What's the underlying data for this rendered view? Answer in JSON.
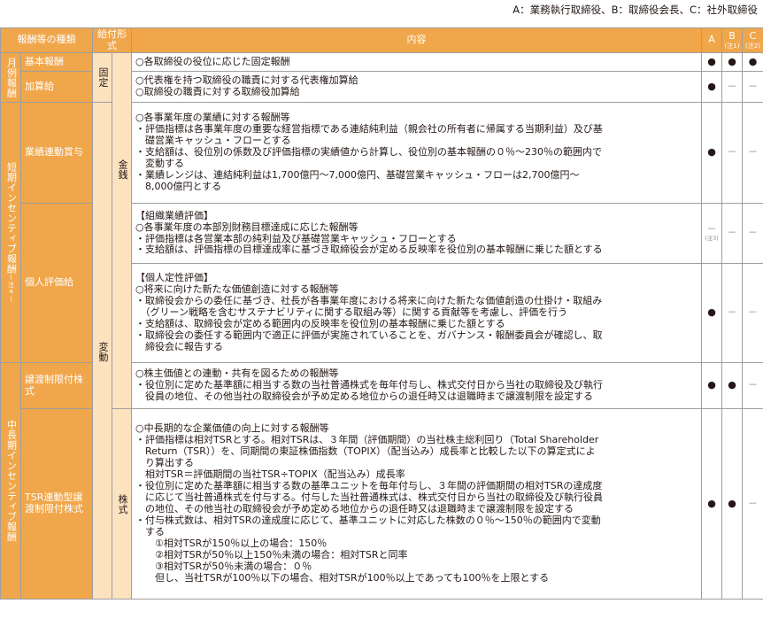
{
  "legend": "A：業務執行取締役、B：取締役会長、C：社外取締役",
  "header": {
    "type": "報酬等の種類",
    "form": "給付形式",
    "content": "内容",
    "a": "A",
    "b": "B",
    "b_note": "(注1)",
    "c": "C",
    "c_note": "(注2)"
  },
  "categories": {
    "monthly": "月例報酬",
    "short": "短期インセンティブ報酬",
    "short_note": "(注4)",
    "long": "中長期インセンティブ報酬"
  },
  "forms": {
    "fixed": "固定",
    "variable": "変動",
    "money": "金銭",
    "stock": "株式"
  },
  "rows": [
    {
      "name": "基本報酬",
      "lines": [
        "○各取締役の役位に応じた固定報酬"
      ],
      "a": "●",
      "b": "●",
      "c": "●"
    },
    {
      "name": "加算給",
      "lines": [
        "○代表権を持つ取締役の職責に対する代表権加算給",
        "○取締役の職責に対する取締役加算給"
      ],
      "a": "●",
      "b": "－",
      "c": "－"
    },
    {
      "name": "業績連動賞与",
      "lines": [
        "○各事業年度の業績に対する報酬等",
        "・評価指標は各事業年度の重要な経営指標である連結純利益（親会社の所有者に帰属する当期利益）及び基",
        "　礎営業キャッシュ・フローとする",
        "・支給額は、役位別の係数及び評価指標の実績値から計算し、役位別の基本報酬の０％～230％の範囲内で",
        "　変動する",
        "・業績レンジは、連結純利益は1,700億円～7,000億円、基礎営業キャッシュ・フローは2,700億円～",
        "　8,000億円とする"
      ],
      "a": "●",
      "b": "－",
      "c": "－"
    },
    {
      "name": "個人評価給",
      "lines": [
        "【組織業績評価】",
        "○各事業年度の本部別財務目標達成に応じた報酬等",
        "・評価指標は各営業本部の純利益及び基礎営業キャッシュ・フローとする",
        "・支給額は、評価指標の目標達成率に基づき取締役会が定める反映率を役位別の基本報酬に乗じた額とする"
      ],
      "a": "－",
      "a_note": "(注3)",
      "b": "－",
      "c": "－"
    },
    {
      "lines": [
        "【個人定性評価】",
        "○将来に向けた新たな価値創造に対する報酬等",
        "・取締役会からの委任に基づき、社長が各事業年度における将来に向けた新たな価値創造の仕掛け・取組み",
        "　（グリーン戦略を含むサステナビリティに関する取組み等）に関する貢献等を考慮し、評価を行う",
        "・支給額は、取締役会が定める範囲内の反映率を役位別の基本報酬に乗じた額とする",
        "・取締役会の委任する範囲内で適正に評価が実施されていることを、ガバナンス・報酬委員会が確認し、取",
        "　締役会に報告する"
      ],
      "a": "●",
      "b": "－",
      "c": "－"
    },
    {
      "name": "譲渡制限付株式",
      "lines": [
        "○株主価値との連動・共有を図るための報酬等",
        "・役位別に定めた基準額に相当する数の当社普通株式を毎年付与し、株式交付日から当社の取締役及び執行",
        "　役員の地位、その他当社の取締役会が予め定める地位からの退任時又は退職時まで譲渡制限を設定する"
      ],
      "a": "●",
      "b": "●",
      "c": "－"
    },
    {
      "name": "TSR連動型譲渡制限付株式",
      "lines": [
        "○中長期的な企業価値の向上に対する報酬等",
        "・評価指標は相対TSRとする。相対TSRは、３年間（評価期間）の当社株主総利回り（Total Shareholder",
        "　Return（TSR））を、同期間の東証株価指数（TOPIX）（配当込み）成長率と比較した以下の算定式によ",
        "　り算出する",
        "　相対TSR＝評価期間の当社TSR÷TOPIX（配当込み）成長率",
        "・役位別に定めた基準額に相当する数の基準ユニットを毎年付与し、３年間の評価期間の相対TSRの達成度",
        "　に応じて当社普通株式を付与する。付与した当社普通株式は、株式交付日から当社の取締役及び執行役員",
        "　の地位、その他当社の取締役会が予め定める地位からの退任時又は退職時まで譲渡制限を設定する",
        "・付与株式数は、相対TSRの達成度に応じて、基準ユニットに対応した株数の０％～150％の範囲内で変動",
        "　する",
        "　　①相対TSRが150％以上の場合：150％",
        "　　②相対TSRが50％以上150％未満の場合：相対TSRと同率",
        "　　③相対TSRが50％未満の場合：０％",
        "　　但し、当社TSRが100％以下の場合、相対TSRが100％以上であっても100％を上限とする"
      ],
      "a": "●",
      "b": "●",
      "c": "－"
    }
  ]
}
